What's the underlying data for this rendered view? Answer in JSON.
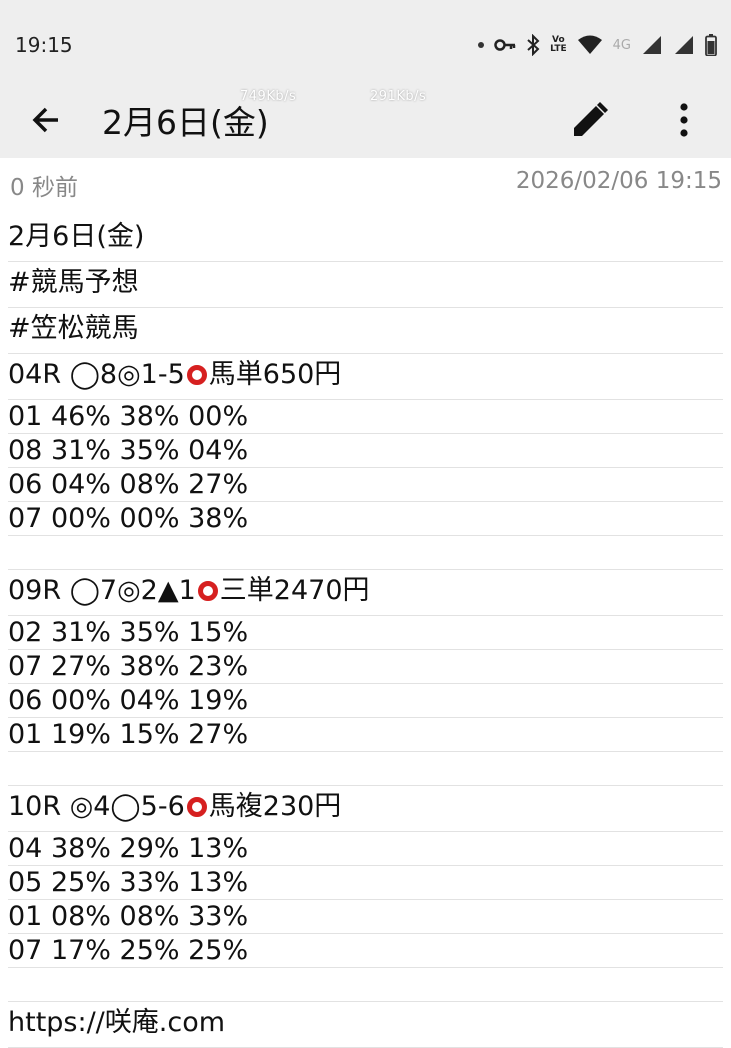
{
  "status_bar": {
    "time": "19:15",
    "net_label": "4G",
    "volte_line1": "Vo",
    "volte_line2": "LTE",
    "icons": [
      "dot-icon",
      "key-icon",
      "bluetooth-icon",
      "volte-icon",
      "wifi-icon",
      "signal-icon",
      "battery-icon"
    ]
  },
  "appbar": {
    "title": "2月6日(金)",
    "speed_down": "749Kb/s",
    "speed_up": "291Kb/s",
    "icons": [
      "back-arrow-icon",
      "pencil-icon",
      "more-vert-icon"
    ]
  },
  "meta": {
    "elapsed": "0 秒前",
    "timestamp": "2026/02/06 19:15"
  },
  "note": {
    "date_line": "2月6日(金)",
    "tag1": "#競馬予想",
    "tag2": "#笠松競馬",
    "race1": {
      "prefix": "04R ◯8◎1-5",
      "result": "馬単650円",
      "rows": [
        "01 46% 38% 00%",
        "08 31% 35% 04%",
        "06 04% 08% 27%",
        "07 00% 00% 38%"
      ]
    },
    "race2": {
      "prefix": "09R ◯7◎2▲1",
      "result": "三単2470円",
      "rows": [
        "02 31% 35% 15%",
        "07 27% 38% 23%",
        "06 00% 04% 19%",
        "01 19% 15% 27%"
      ]
    },
    "race3": {
      "prefix": "10R ◎4◯5-6",
      "result": "馬複230円",
      "rows": [
        "04 38% 29% 13%",
        "05 25% 33% 13%",
        "01 08% 08% 33%",
        "07 17% 25% 25%"
      ]
    },
    "url": "https://咲庵.com"
  },
  "colors": {
    "bar_bg": "#eeeeee",
    "ring_red": "#d62020",
    "meta_gray": "#888888"
  }
}
